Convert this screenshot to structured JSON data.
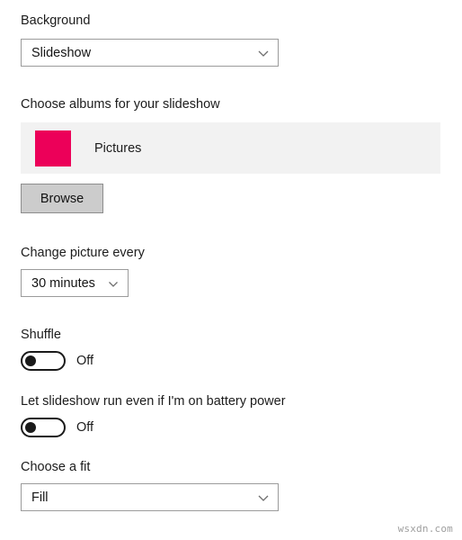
{
  "background_section": {
    "label": "Background",
    "dropdown": {
      "value": "Slideshow",
      "icon": "chevron-down-icon"
    }
  },
  "albums_section": {
    "label": "Choose albums for your slideshow",
    "items": [
      {
        "name": "Pictures",
        "thumbnail_color": "#ec0059"
      }
    ],
    "browse_button": "Browse"
  },
  "interval_section": {
    "label": "Change picture every",
    "dropdown": {
      "value": "30 minutes",
      "icon": "chevron-down-icon"
    }
  },
  "shuffle_section": {
    "label": "Shuffle",
    "toggle": {
      "state": "Off",
      "on": false
    }
  },
  "battery_section": {
    "label": "Let slideshow run even if I'm on battery power",
    "toggle": {
      "state": "Off",
      "on": false
    }
  },
  "fit_section": {
    "label": "Choose a fit",
    "dropdown": {
      "value": "Fill",
      "icon": "chevron-down-icon"
    }
  },
  "watermark": {
    "text": "wsxdn.com"
  },
  "colors": {
    "accent_pink": "#ec0059",
    "panel_background": "#f2f2f2",
    "control_border": "#9b9b9b",
    "button_face": "#cccccc",
    "text": "#1c1c1c"
  }
}
